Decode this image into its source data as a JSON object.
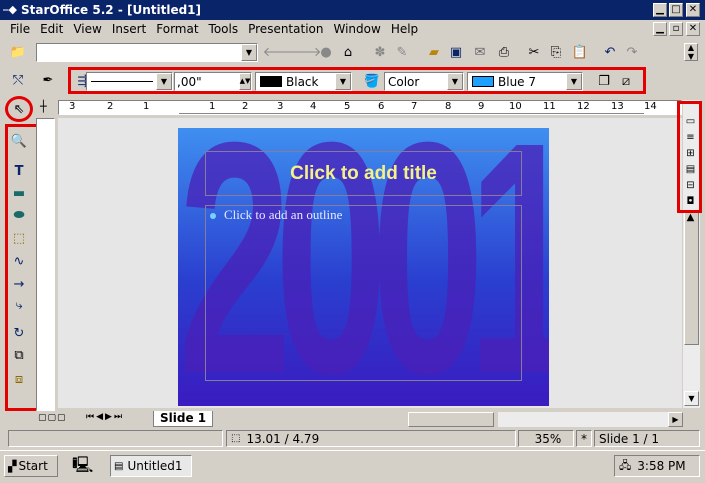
{
  "window": {
    "title": "StarOffice 5.2 - [Untitled1]"
  },
  "menu": [
    "File",
    "Edit",
    "View",
    "Insert",
    "Format",
    "Tools",
    "Presentation",
    "Window",
    "Help"
  ],
  "toolbar": {
    "url_value": ""
  },
  "objectbar": {
    "line_width": ",00\"",
    "line_color": "Black",
    "area_style": "Color",
    "area_fill": "Blue 7",
    "line_color_hex": "#000000",
    "area_fill_hex": "#1ea0ff"
  },
  "ruler": {
    "labels": [
      "3",
      "2",
      "1",
      "1",
      "2",
      "3",
      "4",
      "5",
      "6",
      "7",
      "8",
      "9",
      "10",
      "11",
      "12",
      "13",
      "14"
    ]
  },
  "slide": {
    "title_placeholder": "Click to add title",
    "outline_placeholder": "Click to add an outline",
    "background_text": "2001"
  },
  "tabs": {
    "active": "Slide 1"
  },
  "status": {
    "position": "13.01 / 4.79",
    "zoom": "35%",
    "modified": "*",
    "page": "Slide 1 / 1"
  },
  "taskbar": {
    "start": "Start",
    "task": "Untitled1",
    "clock": "3:58 PM"
  }
}
